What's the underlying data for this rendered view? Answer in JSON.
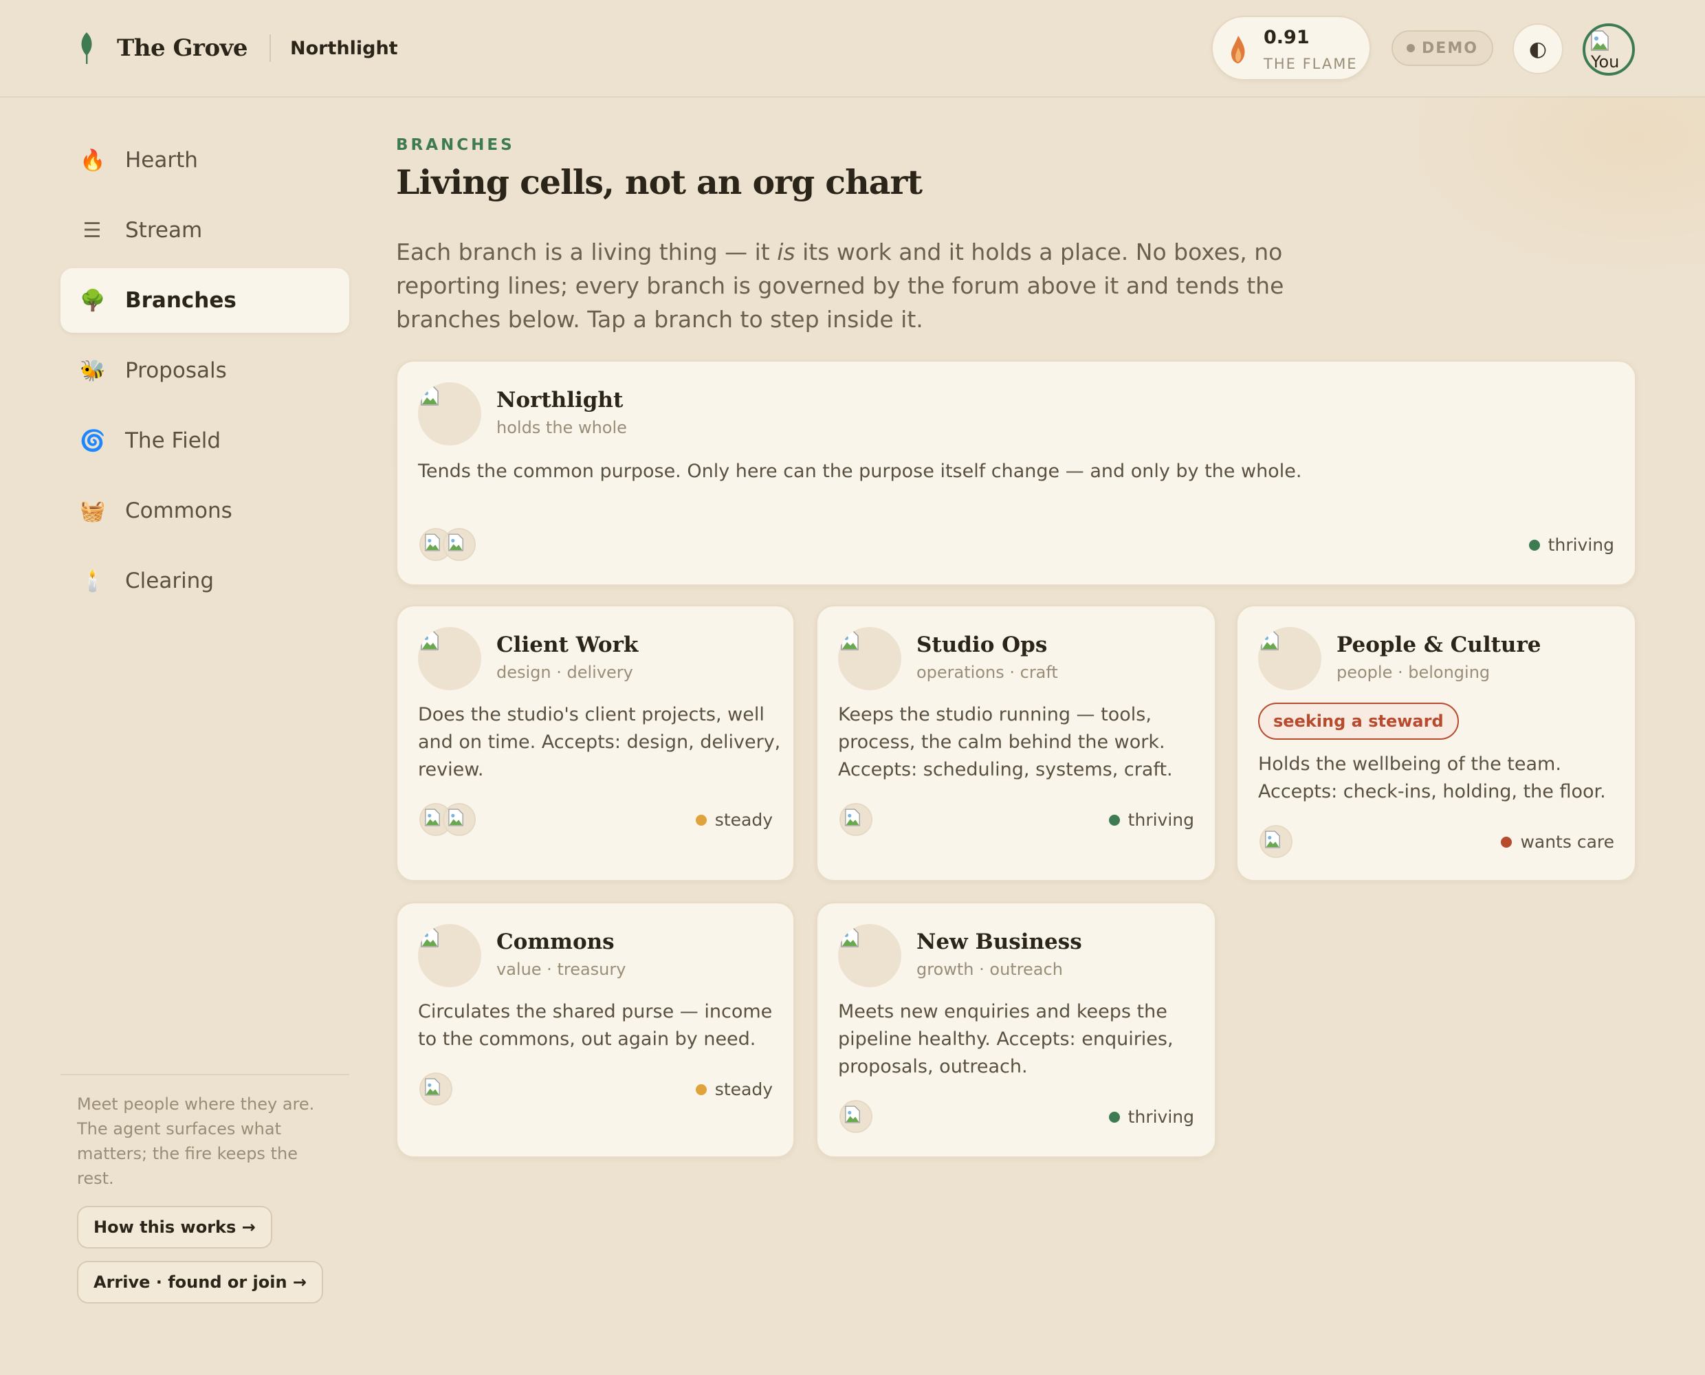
{
  "header": {
    "app_name": "The Grove",
    "org_name": "Northlight",
    "flame_value": "0.91",
    "flame_label": "THE FLAME",
    "demo_label": "DEMO",
    "theme_icon": "◐",
    "avatar_alt": "You"
  },
  "sidebar": {
    "items": [
      {
        "icon": "🔥",
        "label": "Hearth"
      },
      {
        "icon": "☰",
        "label": "Stream"
      },
      {
        "icon": "🌳",
        "label": "Branches"
      },
      {
        "icon": "🐝",
        "label": "Proposals"
      },
      {
        "icon": "🌀",
        "label": "The Field"
      },
      {
        "icon": "🧺",
        "label": "Commons"
      },
      {
        "icon": "🕯️",
        "label": "Clearing"
      }
    ],
    "active": "Branches",
    "note": "Meet people where they are. The agent surfaces what matters; the fire keeps the rest.",
    "how_link": "How this works →",
    "arrive_link": "Arrive · found or join →"
  },
  "main": {
    "eyebrow": "BRANCHES",
    "title": "Living cells, not an org chart",
    "lede_before": "Each branch is a living thing — it ",
    "lede_em": "is",
    "lede_after": " its work and it holds a place. No boxes, no reporting lines; every branch is governed by the forum above it and tends the branches below. Tap a branch to step inside it."
  },
  "branches": [
    {
      "name": "Northlight",
      "tags": "holds the whole",
      "desc": "Tends the common purpose. Only here can the purpose itself change — and only by the whole.",
      "status": "thriving",
      "members": 2
    },
    {
      "name": "Client Work",
      "tags": "design · delivery",
      "desc": "Does the studio's client projects, well and on time. Accepts: design, delivery, review.",
      "status": "steady",
      "members": 2
    },
    {
      "name": "Studio Ops",
      "tags": "operations · craft",
      "desc": "Keeps the studio running — tools, process, the calm behind the work. Accepts: scheduling, systems, craft.",
      "status": "thriving",
      "members": 1
    },
    {
      "name": "People & Culture",
      "tags": "people · belonging",
      "badge": "seeking a steward",
      "desc": "Holds the wellbeing of the team. Accepts: check-ins, holding, the floor.",
      "status": "wants care",
      "members": 1
    },
    {
      "name": "Commons",
      "tags": "value · treasury",
      "desc": "Circulates the shared purse — income to the commons, out again by need.",
      "status": "steady",
      "members": 1
    },
    {
      "name": "New Business",
      "tags": "growth · outreach",
      "desc": "Meets new enquiries and keeps the pipeline healthy. Accepts: enquiries, proposals, outreach.",
      "status": "thriving",
      "members": 1
    }
  ],
  "colors": {
    "background": "#ede2d0",
    "card": "#faf5ea",
    "accent_green": "#3e7a52",
    "thriving": "#3e7a52",
    "steady": "#e0a23a",
    "wants_care": "#b84a2e",
    "flame": "#e07a3a"
  }
}
